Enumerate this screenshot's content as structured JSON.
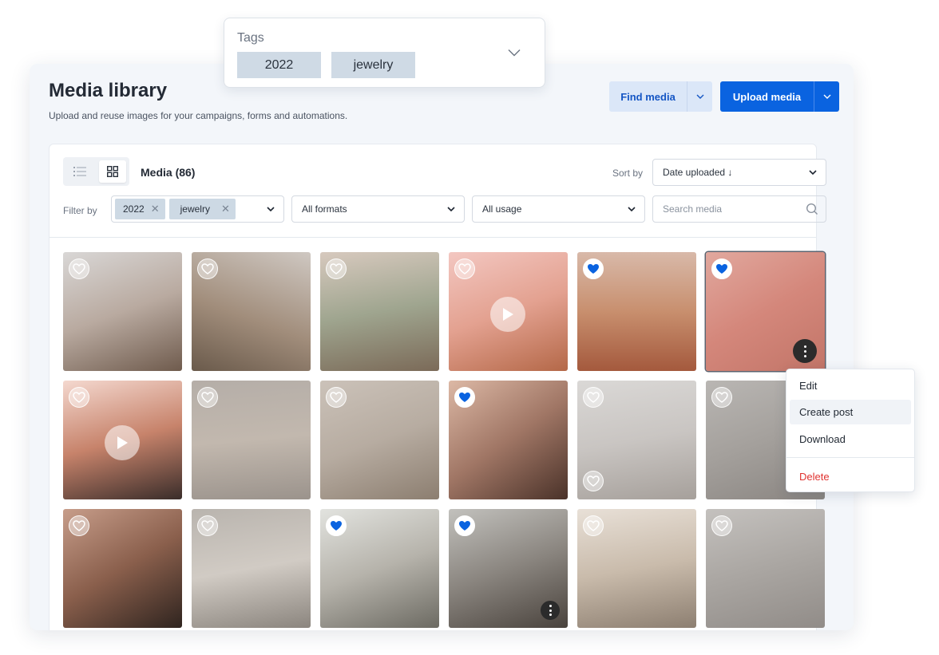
{
  "header": {
    "title": "Media library",
    "subtitle": "Upload and reuse images for your campaigns, forms and automations.",
    "find_media_label": "Find media",
    "upload_media_label": "Upload media"
  },
  "toolbar": {
    "media_count_label": "Media (86)",
    "sort_label": "Sort by",
    "sort_value": "Date uploaded ↓",
    "filter_label": "Filter by",
    "filter_tags": [
      "2022",
      "jewelry"
    ],
    "format_value": "All formats",
    "usage_value": "All usage",
    "search_placeholder": "Search media"
  },
  "tags_popover": {
    "label": "Tags",
    "tags": [
      "2022",
      "jewelry"
    ]
  },
  "context_menu": {
    "items": [
      "Edit",
      "Create post",
      "Download",
      "Delete"
    ]
  },
  "colors": {
    "primary": "#0a63e0",
    "favorite_heart": "#0a63e0",
    "danger": "#e0322f"
  },
  "media": [
    {
      "favorite": false,
      "play": false,
      "kebab": false
    },
    {
      "favorite": false,
      "play": false,
      "kebab": false
    },
    {
      "favorite": false,
      "play": false,
      "kebab": false
    },
    {
      "favorite": false,
      "play": true,
      "kebab": false
    },
    {
      "favorite": true,
      "play": false,
      "kebab": false
    },
    {
      "favorite": true,
      "play": false,
      "kebab": true,
      "selected": true
    },
    {
      "favorite": false,
      "play": true,
      "kebab": false
    },
    {
      "favorite": false,
      "play": false,
      "kebab": false
    },
    {
      "favorite": false,
      "play": false,
      "kebab": false
    },
    {
      "favorite": true,
      "play": false,
      "kebab": false
    },
    {
      "favorite": false,
      "play": false,
      "kebab": false,
      "extra_heart": true
    },
    {
      "favorite": false,
      "play": false,
      "kebab": false
    },
    {
      "favorite": false,
      "play": false,
      "kebab": false
    },
    {
      "favorite": false,
      "play": false,
      "kebab": false
    },
    {
      "favorite": true,
      "play": false,
      "kebab": false
    },
    {
      "favorite": true,
      "play": false,
      "kebab": true,
      "small_kebab": true
    },
    {
      "favorite": false,
      "play": false,
      "kebab": false
    },
    {
      "favorite": false,
      "play": false,
      "kebab": false
    }
  ]
}
